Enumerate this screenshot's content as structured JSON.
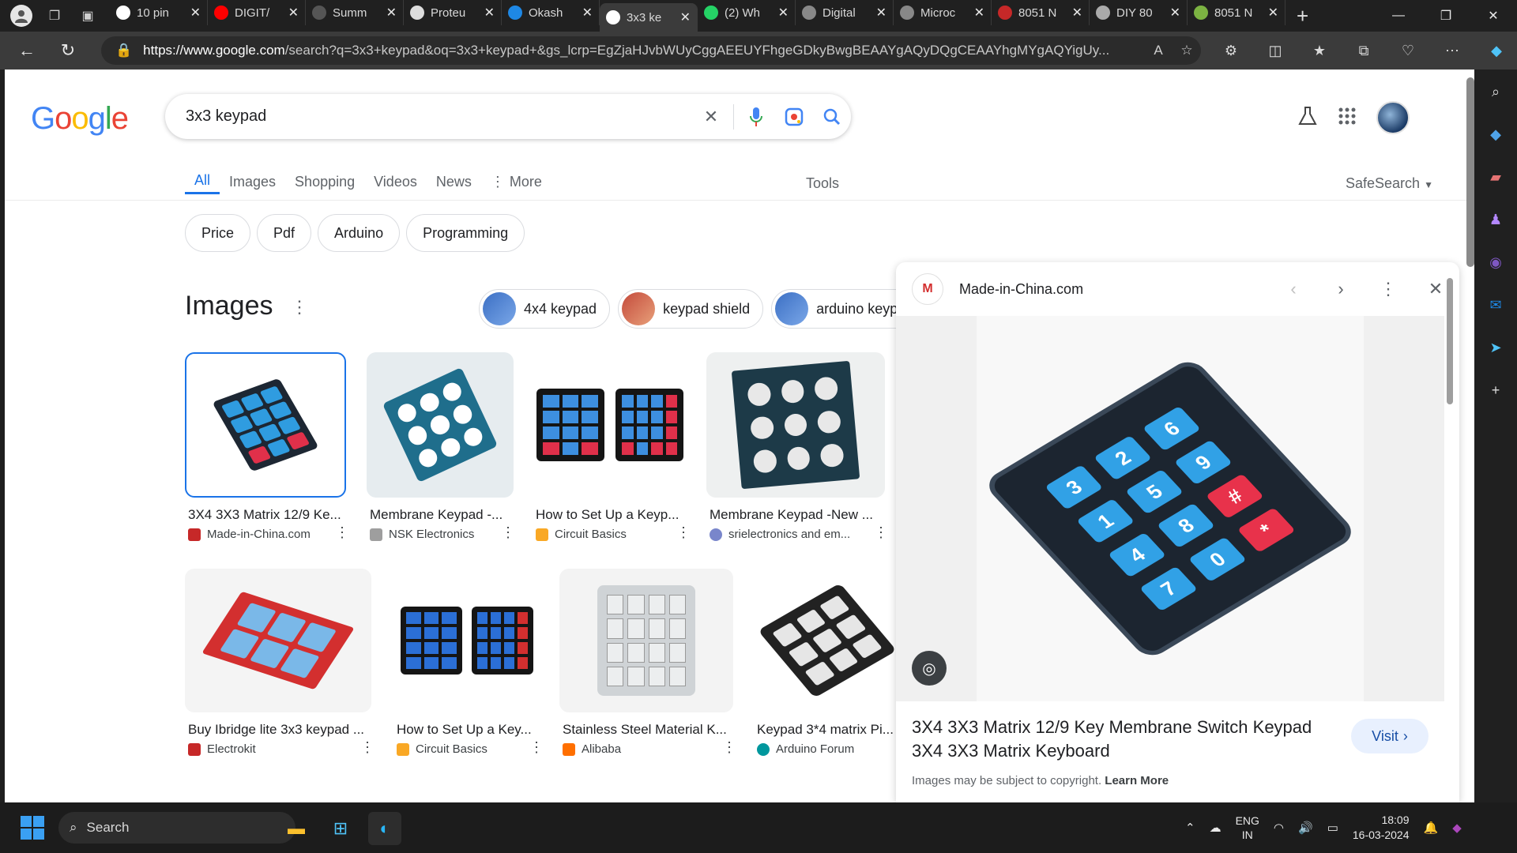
{
  "browser": {
    "tabs": [
      {
        "label": "10 pin",
        "color": "#ffffff"
      },
      {
        "label": "DIGIT/",
        "color": "#ff0000"
      },
      {
        "label": "Summ",
        "color": "#555555"
      },
      {
        "label": "Proteu",
        "color": "#dddddd"
      },
      {
        "label": "Okash",
        "color": "#1e88e5"
      },
      {
        "label": "3x3 ke",
        "color": "#ffffff",
        "active": true
      },
      {
        "label": "(2) Wh",
        "color": "#25d366"
      },
      {
        "label": "Digital",
        "color": "#888888"
      },
      {
        "label": "Microc",
        "color": "#888888"
      },
      {
        "label": "8051 N",
        "color": "#c62828"
      },
      {
        "label": "DIY 80",
        "color": "#aaaaaa"
      },
      {
        "label": "8051 N",
        "color": "#7cb342"
      }
    ],
    "url_domain": "https://www.google.com",
    "url_rest": "/search?q=3x3+keypad&oq=3x3+keypad+&gs_lcrp=EgZjaHJvbWUyCggAEEUYFhgeGDkyBwgBEAAYgAQyDQgCEAAYhgMYgAQYigUy..."
  },
  "google": {
    "logo": {
      "g1": "G",
      "o1": "o",
      "o2": "o",
      "g2": "g",
      "l": "l",
      "e": "e"
    },
    "query": "3x3 keypad",
    "tabs": [
      "All",
      "Images",
      "Shopping",
      "Videos",
      "News",
      "More"
    ],
    "tools": "Tools",
    "safesearch": "SafeSearch",
    "chips": [
      "Price",
      "Pdf",
      "Arduino",
      "Programming"
    ],
    "images_heading": "Images",
    "related": [
      "4x4 keypad",
      "keypad shield",
      "arduino keypad"
    ],
    "results": [
      {
        "title": "3X4 3X3 Matrix 12/9 Ke...",
        "source": "Made-in-China.com",
        "fav": "#c62828"
      },
      {
        "title": "Membrane Keypad -...",
        "source": "NSK Electronics",
        "fav": "#9e9e9e"
      },
      {
        "title": "How to Set Up a Keyp...",
        "source": "Circuit Basics",
        "fav": "#f9a825"
      },
      {
        "title": "Membrane Keypad -New ...",
        "source": "srielectronics and em...",
        "fav": "#7986cb"
      },
      {
        "title": "Buy Ibridge lite 3x3 keypad ...",
        "source": "Electrokit",
        "fav": "#c62828"
      },
      {
        "title": "How to Set Up a Key...",
        "source": "Circuit Basics",
        "fav": "#f9a825"
      },
      {
        "title": "Stainless Steel Material K...",
        "source": "Alibaba",
        "fav": "#ff6f00"
      },
      {
        "title": "Keypad 3*4 matrix Pi...",
        "source": "Arduino Forum",
        "fav": "#00979d"
      }
    ]
  },
  "panel": {
    "site": "Made-in-China.com",
    "title": "3X4 3X3 Matrix 12/9 Key Membrane Switch Keypad 3X4 3X3 Matrix Keyboard",
    "visit": "Visit",
    "copyright": "Images may be subject to copyright.",
    "learn_more": "Learn More",
    "keys": [
      "3",
      "2",
      "6",
      "1",
      "5",
      "9",
      "4",
      "8",
      "#",
      "7",
      "0",
      "*"
    ]
  },
  "taskbar": {
    "search": "Search",
    "lang1": "ENG",
    "lang2": "IN",
    "time": "18:09",
    "date": "16-03-2024"
  }
}
